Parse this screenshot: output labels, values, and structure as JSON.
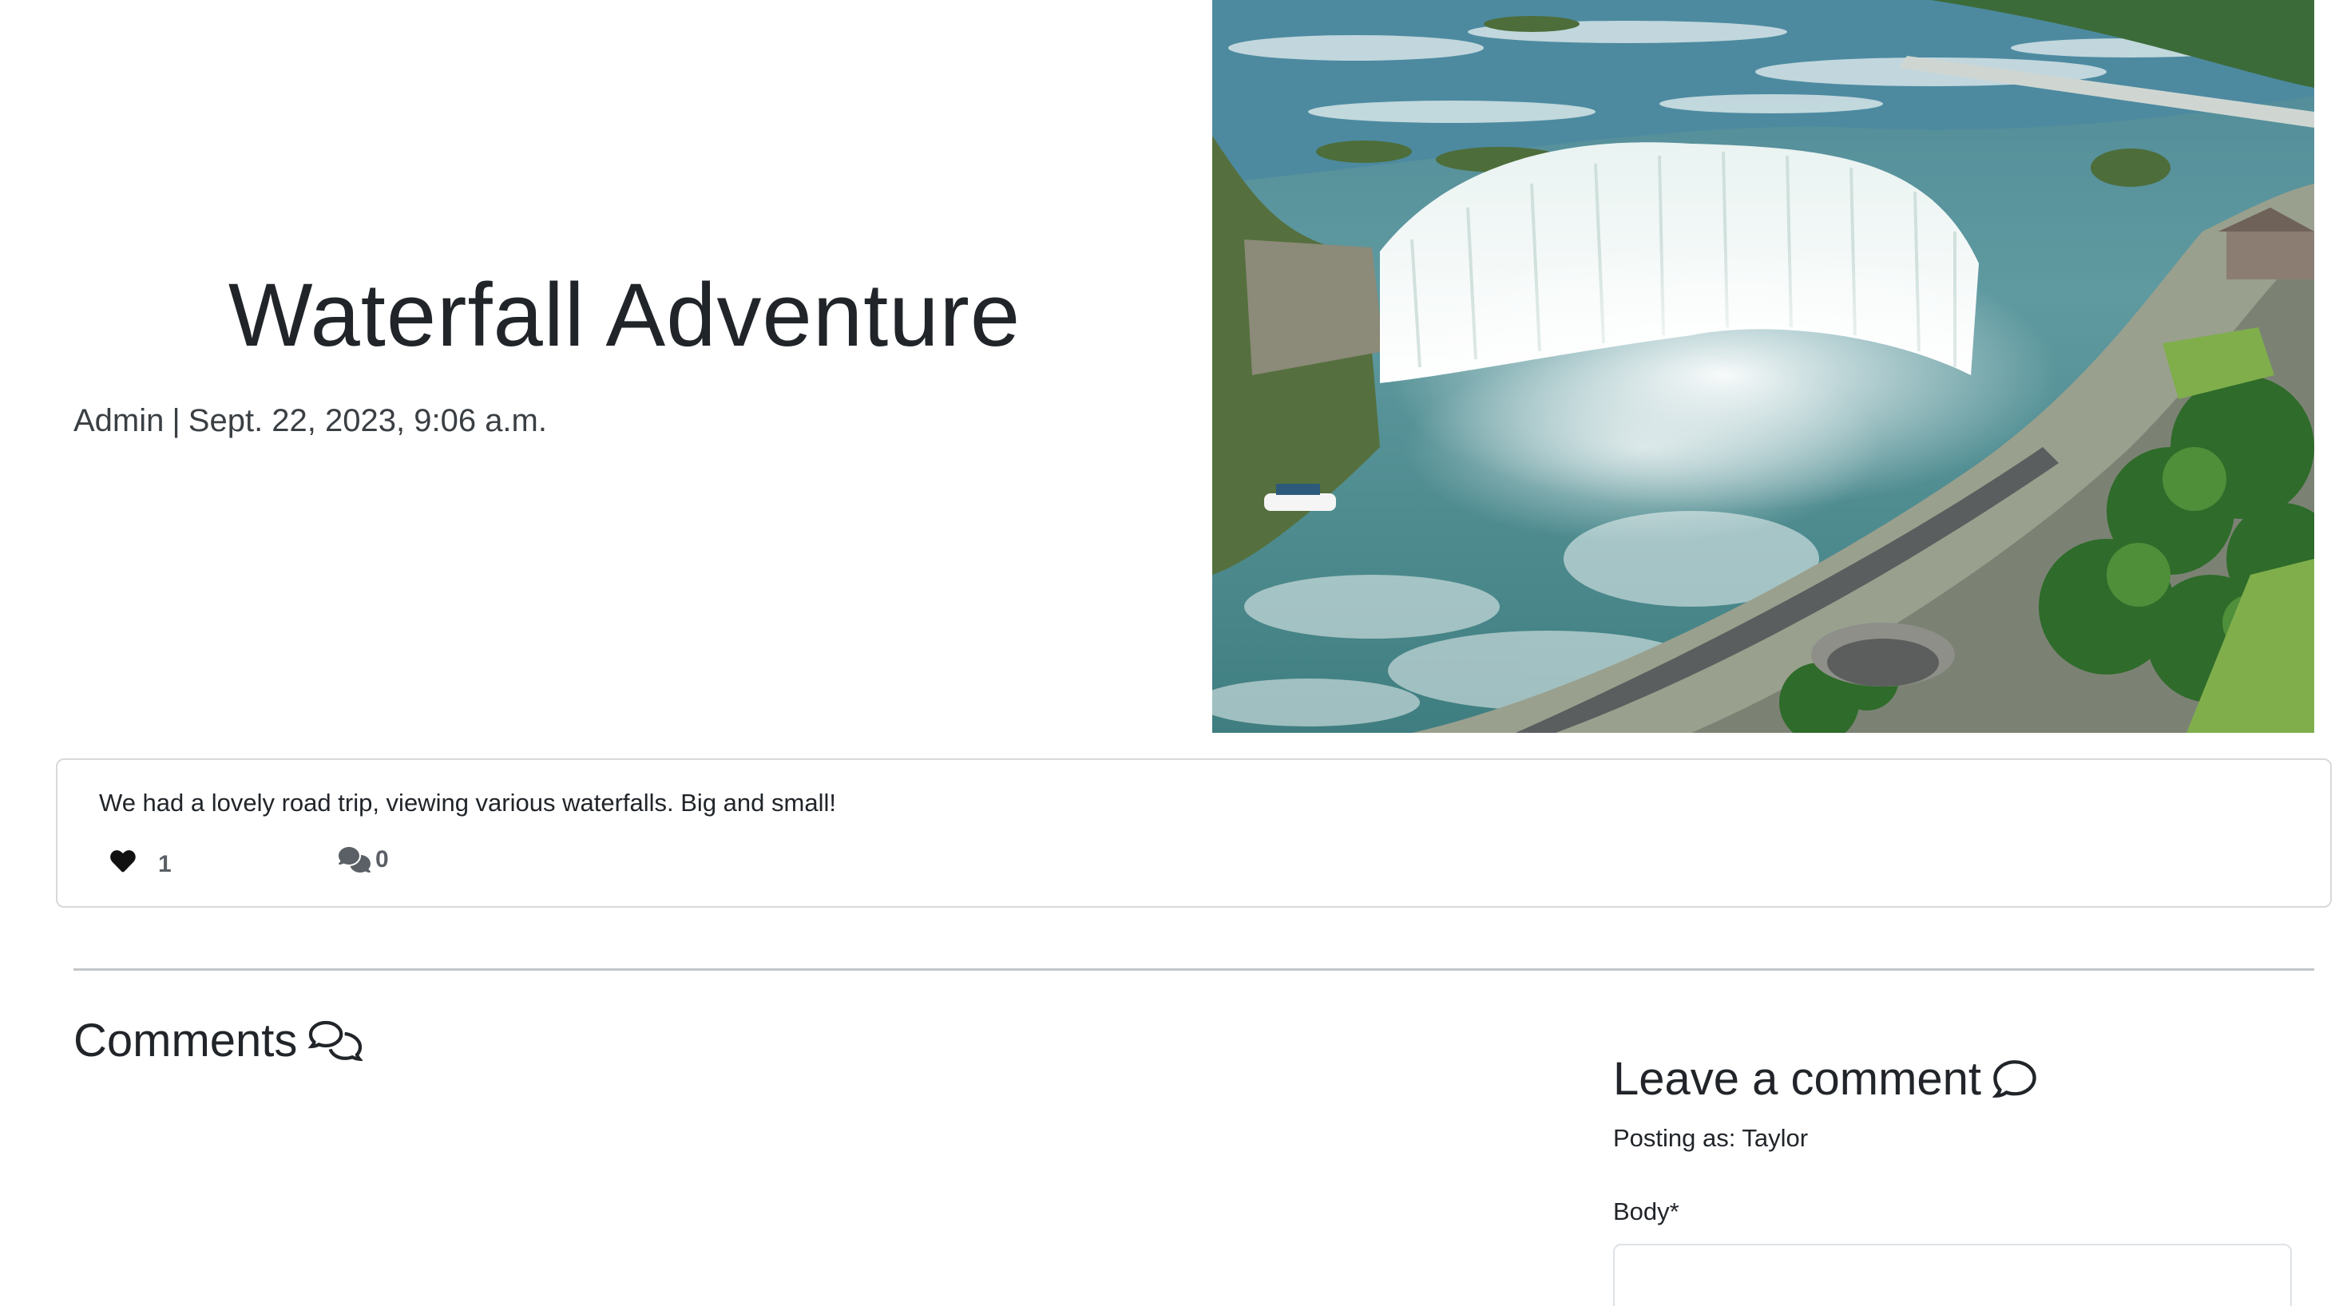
{
  "post": {
    "title": "Waterfall Adventure",
    "author": "Admin",
    "separator": "|",
    "date": "Sept. 22, 2023, 9:06 a.m.",
    "content": "We had a lovely road trip, viewing various waterfalls. Big and small!",
    "likes": "1",
    "comment_count": "0"
  },
  "comments_section": {
    "heading": "Comments"
  },
  "comment_form": {
    "heading": "Leave a comment",
    "posting_as": "Posting as: Taylor",
    "body_label": "Body*",
    "body_value": ""
  },
  "icons": {
    "like": "heart-icon",
    "comments_count": "comments-icon",
    "comments_heading": "comments-outline-icon",
    "leave_comment": "comment-outline-icon"
  },
  "colors": {
    "text": "#212529",
    "muted": "#5a6066",
    "border": "#d7d9db"
  }
}
